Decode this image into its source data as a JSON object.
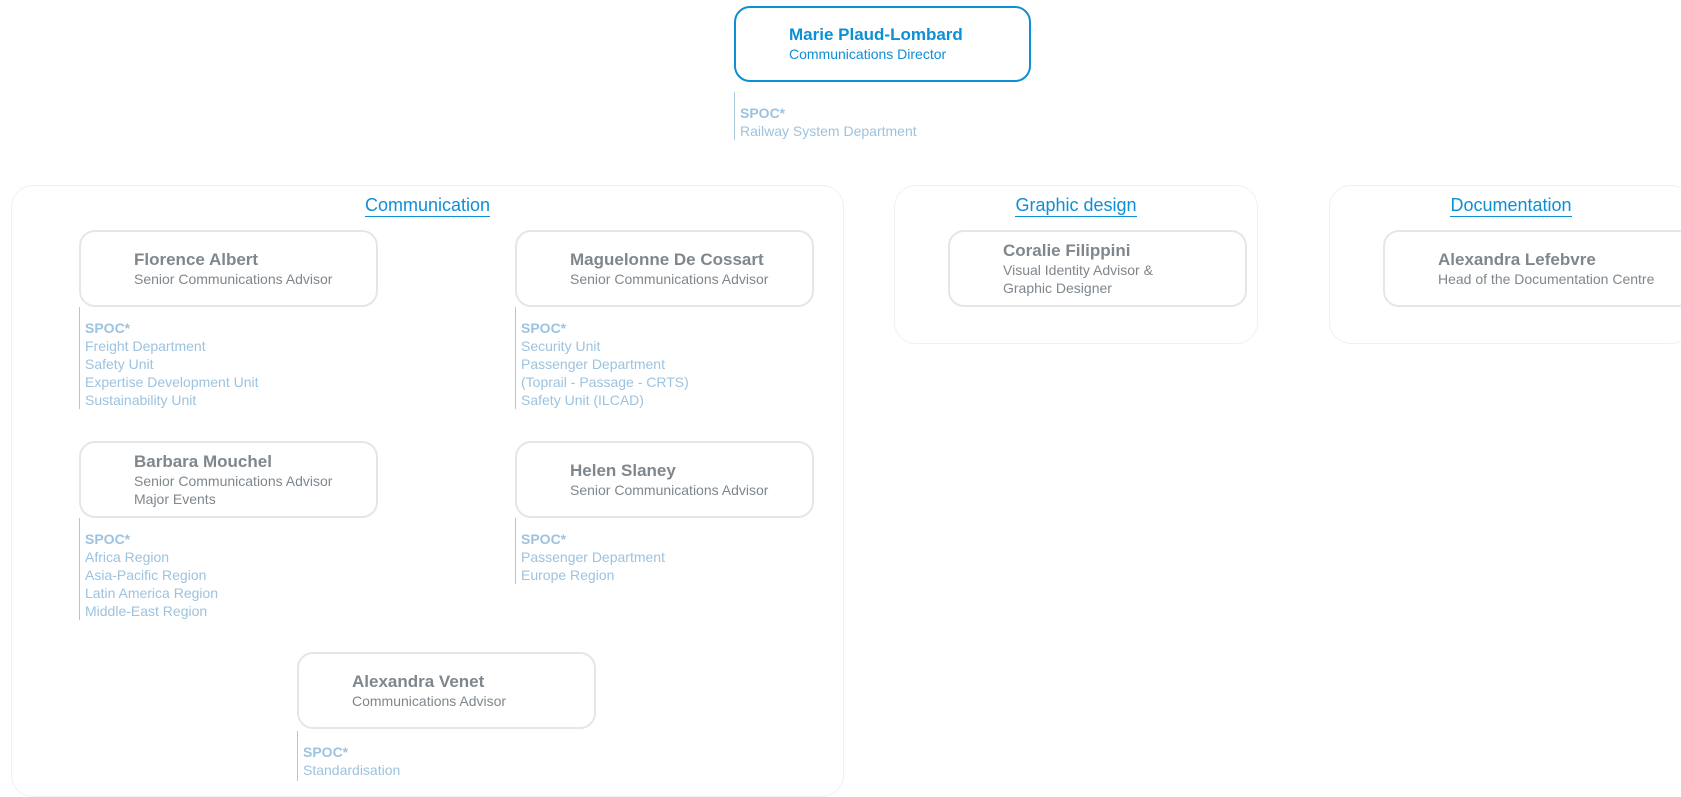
{
  "director": {
    "name": "Marie Plaud-Lombard",
    "role": "Communications Director"
  },
  "director_spoc": {
    "label": "SPOC*",
    "items": [
      "Railway System Department"
    ]
  },
  "groups": {
    "communication": {
      "title": "Communication",
      "members": [
        {
          "name": "Florence Albert",
          "roles": [
            "Senior Communications Advisor"
          ],
          "spoc": {
            "label": "SPOC*",
            "items": [
              "Freight Department",
              "Safety Unit",
              "Expertise Development Unit",
              "Sustainability Unit"
            ]
          }
        },
        {
          "name": "Maguelonne De Cossart",
          "roles": [
            "Senior Communications Advisor"
          ],
          "spoc": {
            "label": "SPOC*",
            "items": [
              "Security Unit",
              "Passenger Department",
              "(Toprail - Passage - CRTS)",
              "Safety Unit (ILCAD)"
            ]
          }
        },
        {
          "name": "Barbara Mouchel",
          "roles": [
            "Senior Communications Advisor",
            "Major Events"
          ],
          "spoc": {
            "label": "SPOC*",
            "items": [
              "Africa Region",
              "Asia-Pacific Region",
              "Latin America Region",
              "Middle-East Region"
            ]
          }
        },
        {
          "name": "Helen Slaney",
          "roles": [
            "Senior Communications Advisor"
          ],
          "spoc": {
            "label": "SPOC*",
            "items": [
              "Passenger Department",
              "Europe Region"
            ]
          }
        },
        {
          "name": "Alexandra Venet",
          "roles": [
            "Communications Advisor"
          ],
          "spoc": {
            "label": "SPOC*",
            "items": [
              "Standardisation"
            ]
          }
        }
      ]
    },
    "graphic_design": {
      "title": "Graphic design",
      "members": [
        {
          "name": "Coralie Filippini",
          "roles": [
            "Visual Identity Advisor &",
            "Graphic Designer"
          ]
        }
      ]
    },
    "documentation": {
      "title": "Documentation",
      "members": [
        {
          "name": "Alexandra Lefebvre",
          "roles": [
            "Head of the Documentation Centre"
          ]
        }
      ]
    }
  },
  "colors": {
    "accent": "#0d8fd6",
    "text_grey": "#7f878d",
    "spoc_text": "#9cc3df",
    "border": "#e4e6e8"
  }
}
